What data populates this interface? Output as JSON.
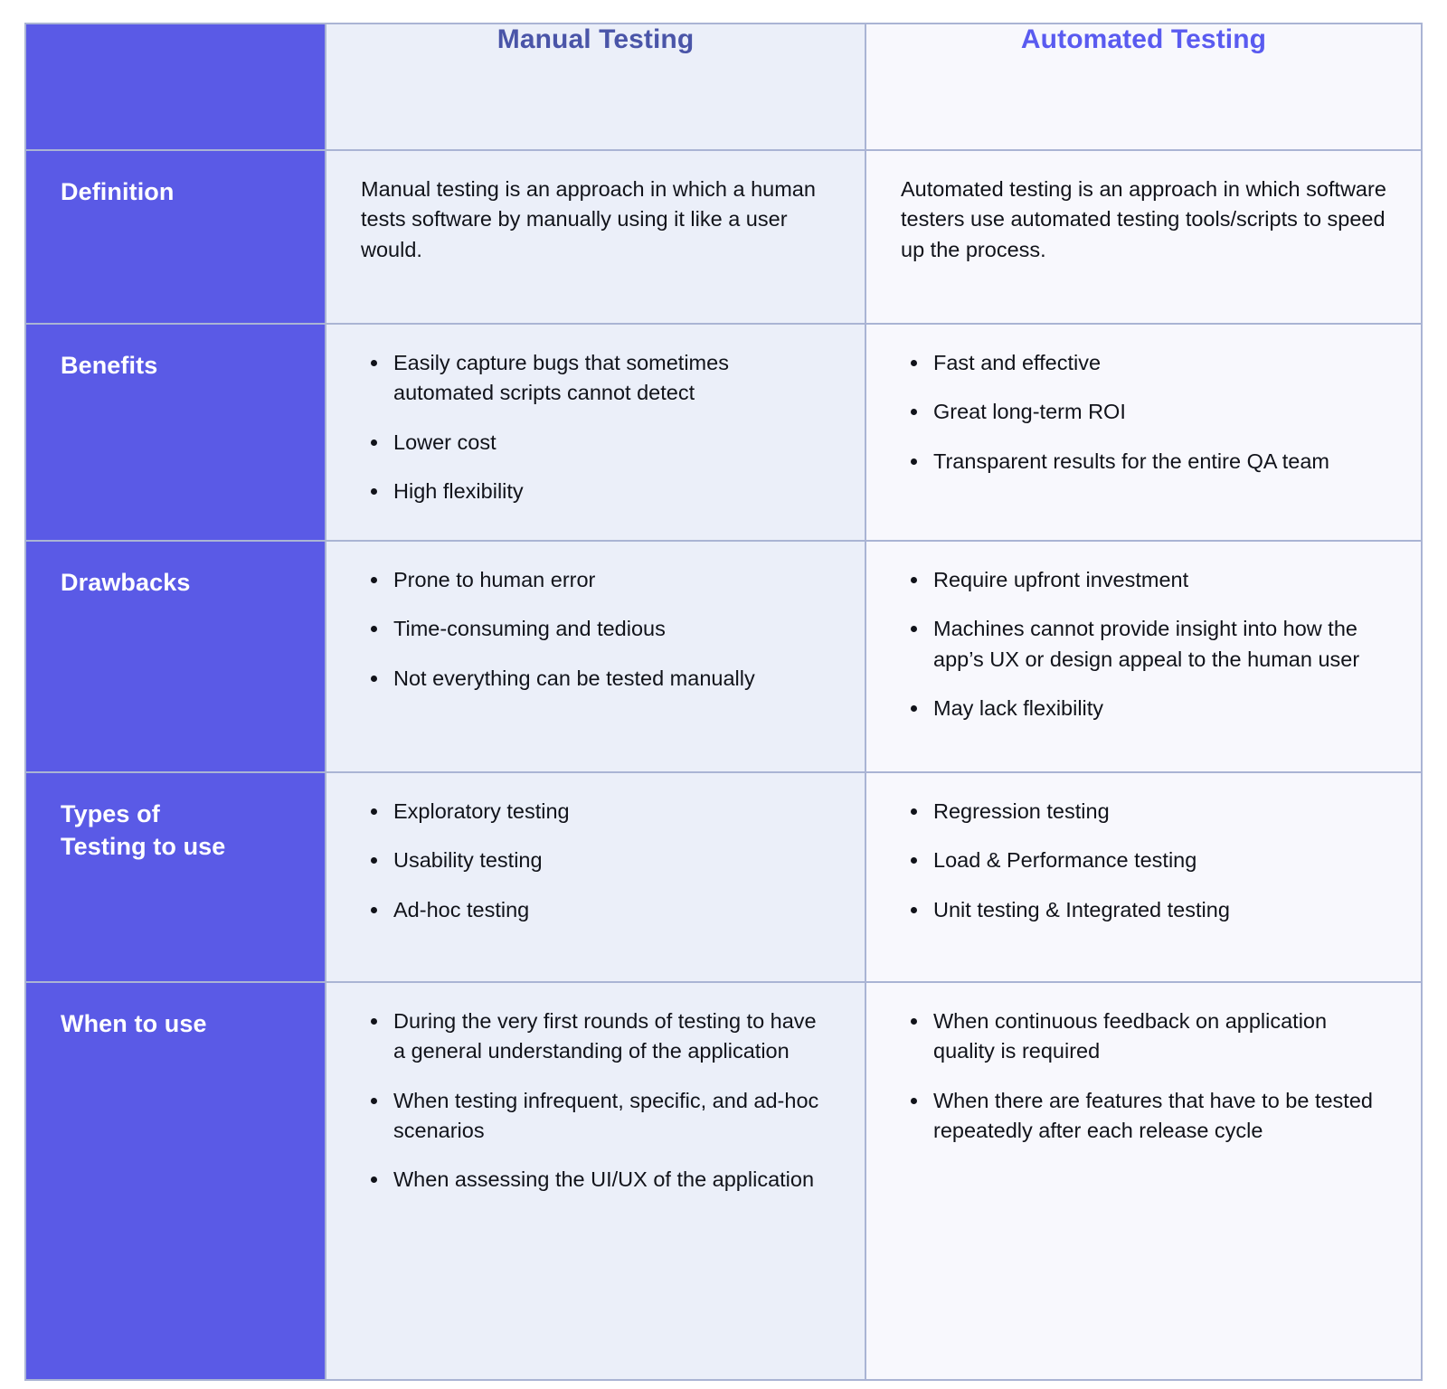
{
  "table": {
    "columns": [
      {
        "key": "label",
        "label": ""
      },
      {
        "key": "manual",
        "label": "Manual Testing"
      },
      {
        "key": "auto",
        "label": "Automated Testing"
      }
    ],
    "colors": {
      "label_column_bg": "#5a5ae6",
      "manual_column_bg": "#ebeff9",
      "automated_column_bg": "#f8f8fd",
      "manual_header_text": "#4a55a8",
      "automated_header_text": "#5a5bf0",
      "border": "#aab4d4",
      "body_text": "#11131a",
      "label_text": "#ffffff"
    },
    "rows": [
      {
        "label": "Definition",
        "manual": {
          "type": "paragraph",
          "text": "Manual testing is an approach in which a human tests software by manually using it like a user would."
        },
        "automated": {
          "type": "paragraph",
          "text": "Automated testing is an approach in which software testers use automated testing tools/scripts to speed up the process."
        }
      },
      {
        "label": "Benefits",
        "manual": {
          "type": "bullets",
          "items": [
            "Easily capture bugs that sometimes automated scripts cannot detect",
            "Lower cost",
            "High flexibility"
          ]
        },
        "automated": {
          "type": "bullets",
          "items": [
            "Fast and effective",
            "Great long-term ROI",
            "Transparent results for the entire QA team"
          ]
        }
      },
      {
        "label": "Drawbacks",
        "manual": {
          "type": "bullets",
          "items": [
            "Prone to human error",
            "Time-consuming and tedious",
            "Not everything can be tested manually"
          ]
        },
        "automated": {
          "type": "bullets",
          "items": [
            "Require upfront investment",
            "Machines cannot provide insight into how the app’s UX or design appeal to the human user",
            "May lack flexibility"
          ]
        }
      },
      {
        "label": "Types of\nTesting to use",
        "label_line1": "Types of",
        "label_line2": "Testing to use",
        "manual": {
          "type": "bullets",
          "items": [
            "Exploratory testing",
            "Usability testing",
            "Ad-hoc testing"
          ]
        },
        "automated": {
          "type": "bullets",
          "items": [
            "Regression testing",
            "Load & Performance testing",
            "Unit testing & Integrated testing"
          ]
        }
      },
      {
        "label": "When to use",
        "manual": {
          "type": "bullets",
          "items": [
            "During the very first rounds of testing to have a general understanding of the application",
            "When testing infrequent, specific, and ad-hoc scenarios",
            "When assessing the UI/UX of the application"
          ]
        },
        "automated": {
          "type": "bullets",
          "items": [
            "When continuous feedback on application quality is required",
            "When there are features that have to be tested repeatedly after each release cycle"
          ]
        }
      }
    ]
  }
}
